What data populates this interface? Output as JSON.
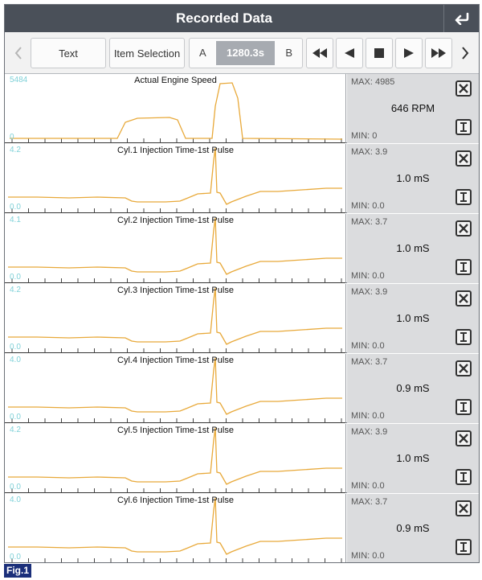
{
  "header": {
    "title": "Recorded Data"
  },
  "toolbar": {
    "text_label": "Text",
    "item_selection_label": "Item Selection",
    "range_a_label": "A",
    "range_b_label": "B",
    "time_value": "1280.3s"
  },
  "figure_label": "Fig.1",
  "colors": {
    "titlebar": "#4a5059",
    "trace": "#e8a93a",
    "axis_label": "#7fd1d8",
    "info_panel": "#dbdcde"
  },
  "channels": [
    {
      "title": "Actual Engine Speed",
      "ymax": "5484",
      "ymin": "0",
      "max_label": "MAX: 4985",
      "min_label": "MIN: 0",
      "value": "646 RPM"
    },
    {
      "title": "Cyl.1 Injection Time-1st Pulse",
      "ymax": "4.2",
      "ymin": "0.0",
      "max_label": "MAX: 3.9",
      "min_label": "MIN: 0.0",
      "value": "1.0 mS"
    },
    {
      "title": "Cyl.2 Injection Time-1st Pulse",
      "ymax": "4.1",
      "ymin": "0.0",
      "max_label": "MAX: 3.7",
      "min_label": "MIN: 0.0",
      "value": "1.0 mS"
    },
    {
      "title": "Cyl.3 Injection Time-1st Pulse",
      "ymax": "4.2",
      "ymin": "0.0",
      "max_label": "MAX: 3.9",
      "min_label": "MIN: 0.0",
      "value": "1.0 mS"
    },
    {
      "title": "Cyl.4 Injection Time-1st Pulse",
      "ymax": "4.0",
      "ymin": "0.0",
      "max_label": "MAX: 3.7",
      "min_label": "MIN: 0.0",
      "value": "0.9 mS"
    },
    {
      "title": "Cyl.5 Injection Time-1st Pulse",
      "ymax": "4.2",
      "ymin": "0.0",
      "max_label": "MAX: 3.9",
      "min_label": "MIN: 0.0",
      "value": "1.0 mS"
    },
    {
      "title": "Cyl.6 Injection Time-1st Pulse",
      "ymax": "4.0",
      "ymin": "0.0",
      "max_label": "MAX: 3.7",
      "min_label": "MIN: 0.0",
      "value": "0.9 mS"
    }
  ]
}
